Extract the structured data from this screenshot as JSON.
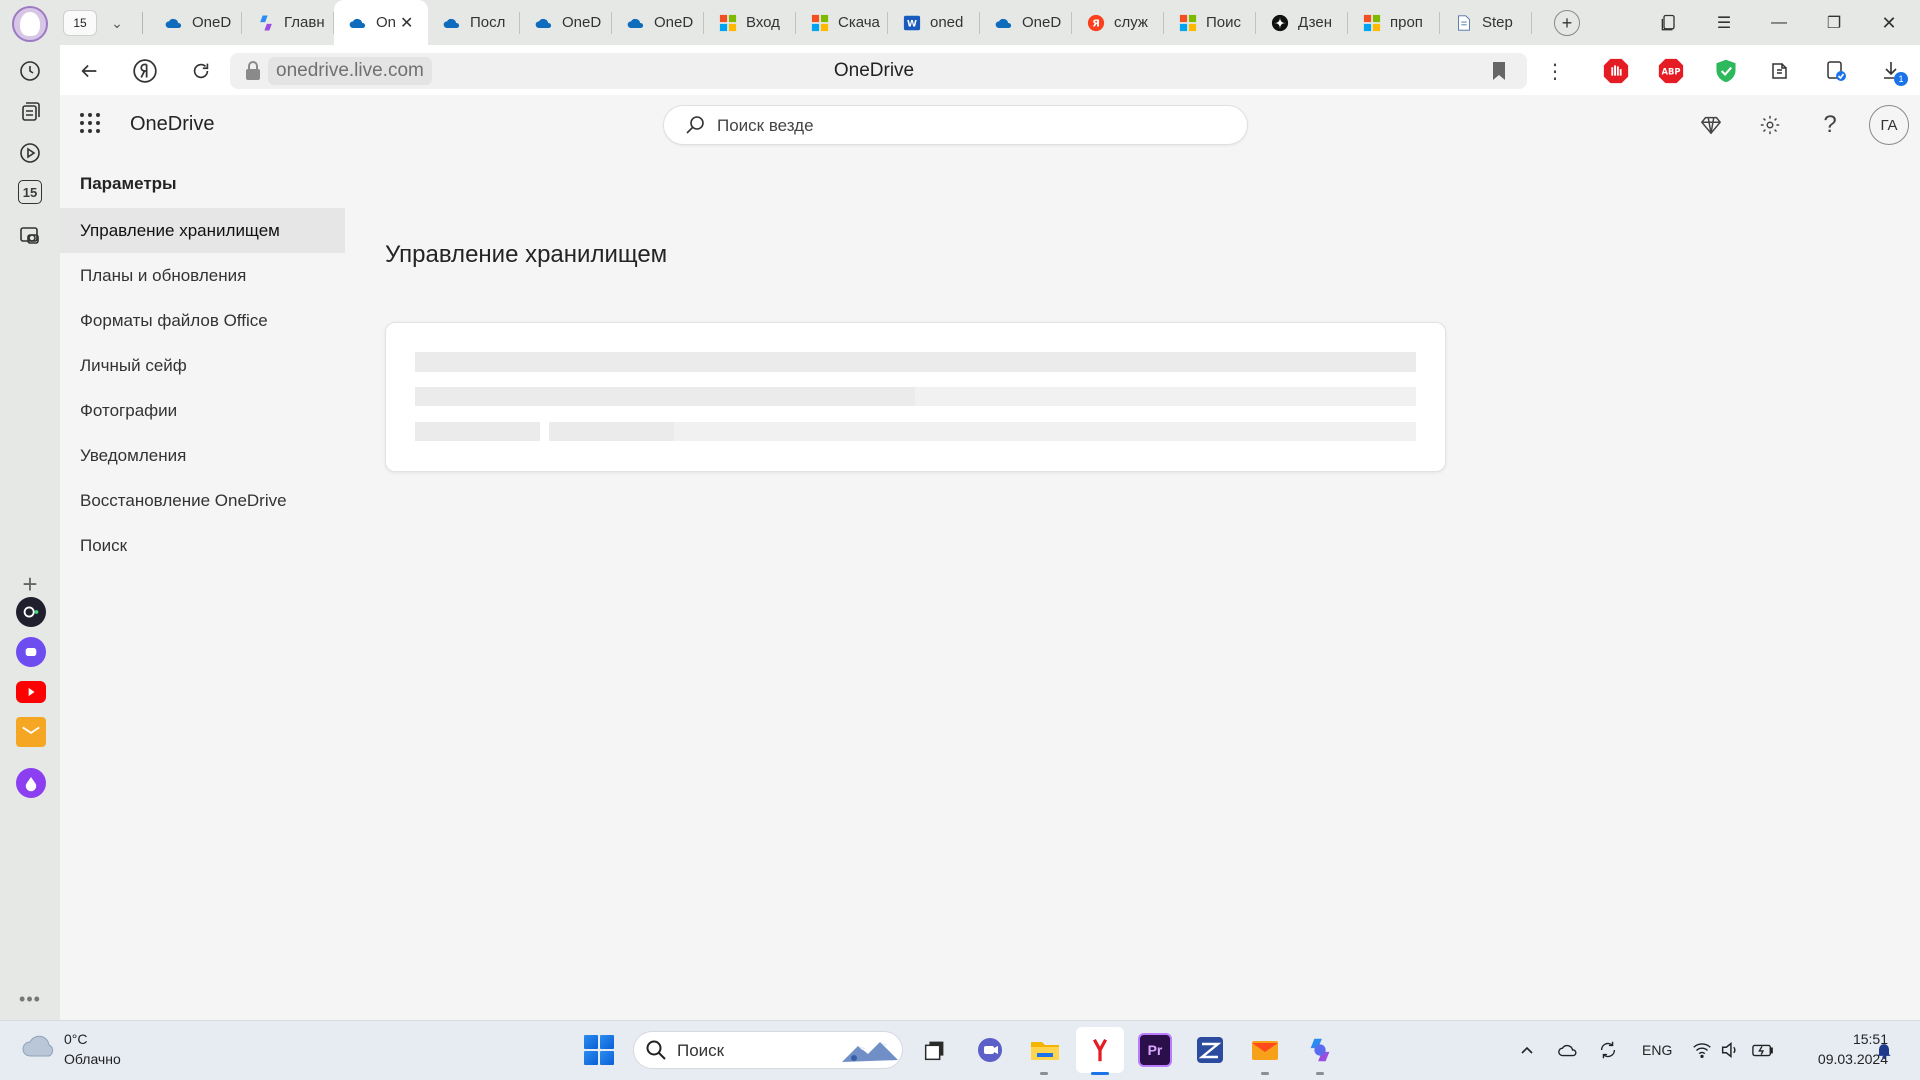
{
  "browser": {
    "tab_count": "15",
    "tabs": [
      {
        "label": "OneD",
        "icon": "onedrive-icon"
      },
      {
        "label": "Главн",
        "icon": "copilot-icon"
      },
      {
        "label": "On",
        "icon": "onedrive-icon",
        "active": true
      },
      {
        "label": "Посл",
        "icon": "onedrive-icon"
      },
      {
        "label": "OneD",
        "icon": "onedrive-icon"
      },
      {
        "label": "OneD",
        "icon": "onedrive-icon"
      },
      {
        "label": "Вход",
        "icon": "microsoft-icon"
      },
      {
        "label": "Скача",
        "icon": "microsoft-icon"
      },
      {
        "label": "oned",
        "icon": "word-icon"
      },
      {
        "label": "OneD",
        "icon": "onedrive-icon"
      },
      {
        "label": "служ",
        "icon": "yandex-icon"
      },
      {
        "label": "Поис",
        "icon": "microsoft-icon"
      },
      {
        "label": "Дзен",
        "icon": "dzen-icon"
      },
      {
        "label": "проп",
        "icon": "microsoft-icon"
      },
      {
        "label": "Step",
        "icon": "document-icon"
      }
    ],
    "url": "onedrive.live.com",
    "page_title": "OneDrive",
    "sidebar_badge": "15",
    "download_badge": "1"
  },
  "app": {
    "brand": "OneDrive",
    "search_placeholder": "Поиск везде",
    "avatar_initials": "ГА"
  },
  "sidebar": {
    "title": "Параметры",
    "items": [
      {
        "label": "Управление хранилищем",
        "active": true
      },
      {
        "label": "Планы и обновления"
      },
      {
        "label": "Форматы файлов Office"
      },
      {
        "label": "Личный сейф"
      },
      {
        "label": "Фотографии"
      },
      {
        "label": "Уведомления"
      },
      {
        "label": "Восстановление OneDrive"
      },
      {
        "label": "Поиск"
      }
    ]
  },
  "main": {
    "title": "Управление хранилищем"
  },
  "taskbar": {
    "weather_temp": "0°C",
    "weather_desc": "Облачно",
    "search_label": "Поиск",
    "language": "ENG",
    "time": "15:51",
    "date": "09.03.2024"
  },
  "colors": {
    "onedrive_blue": "#0f6cbd",
    "page_bg": "#f5f5f5",
    "chrome_bg": "#e6e8e6",
    "active_item_bg": "#e6e6e6"
  }
}
